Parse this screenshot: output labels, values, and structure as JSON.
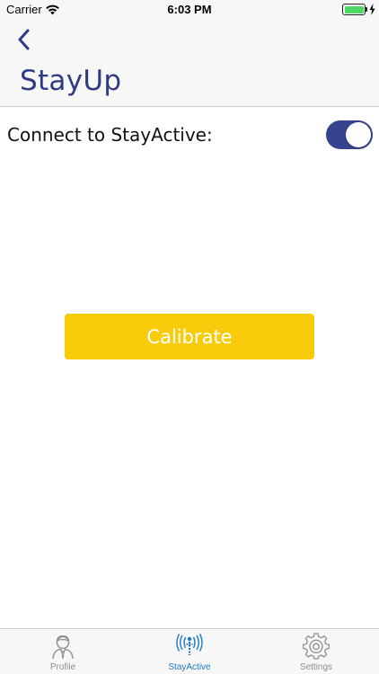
{
  "status_bar": {
    "carrier": "Carrier",
    "time": "6:03 PM",
    "wifi_icon": "wifi-icon",
    "battery_icon": "battery-full-icon",
    "battery_level": 1.0,
    "charging_icon": "charging-bolt-icon"
  },
  "nav": {
    "back_icon": "chevron-left-icon",
    "title": "StayUp"
  },
  "connect": {
    "label": "Connect to StayActive:",
    "toggle_on": true
  },
  "calibrate": {
    "label": "Calibrate"
  },
  "tab_bar": {
    "tabs": [
      {
        "label": "Profile",
        "icon": "person-icon",
        "active": false
      },
      {
        "label": "StayActive",
        "icon": "signal-person-icon",
        "active": true
      },
      {
        "label": "Settings",
        "icon": "gear-icon",
        "active": false
      }
    ]
  },
  "colors": {
    "title": "#2e3b84",
    "toggle_on": "#36448f",
    "calibrate_bg": "#f9cc0b",
    "tab_active": "#1e79c6",
    "tab_inactive": "#8e8e93",
    "battery": "#4cd964"
  }
}
